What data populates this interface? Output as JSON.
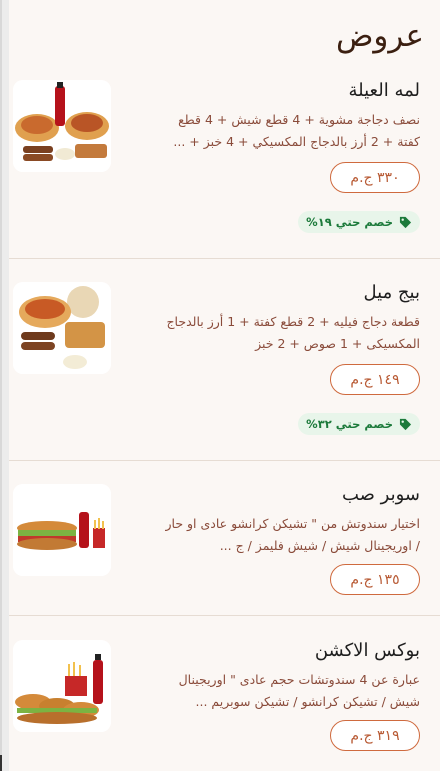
{
  "page": {
    "title": "عروض"
  },
  "offers": [
    {
      "name": "لمه العيلة",
      "description": "نصف دجاجة مشوية + 4 قطع شيش + 4 قطع كفتة + 2 أرز بالدجاج المكسيكي + 4 خبز + ...",
      "price": "٣٣٠ ج.م",
      "discount": "خصم حتي ١٩%",
      "image_icon": "family-meal-image"
    },
    {
      "name": "بيج ميل",
      "description": "قطعة دجاج فيليه + 2 قطع كفتة + 1 أرز بالدجاج المكسيكى + 1 صوص + 2 خبز",
      "price": "١٤٩ ج.م",
      "discount": "خصم حتي ٣٢%",
      "image_icon": "big-meal-image"
    },
    {
      "name": "سوبر صب",
      "description": "اختيار سندوتش من \" تشيكن كرانشو عادى او حار / اوريجينال شيش / شيش فليمز / ج ...",
      "price": "١٣٥ ج.م",
      "discount": "",
      "image_icon": "super-sub-image"
    },
    {
      "name": "بوكس الاكشن",
      "description": "عبارة عن 4 سندوتشات حجم عادى \" اوريجينال شيش / تشيكن كرانشو / تشيكن سوبريم ...",
      "price": "٣١٩ ج.م",
      "discount": "",
      "image_icon": "action-box-image"
    }
  ],
  "colors": {
    "background": "#fbf7f4",
    "accent": "#cf6a3e",
    "description": "#8a4b3a",
    "discount_text": "#1c7a3b",
    "discount_bg": "#e8f5ea"
  }
}
